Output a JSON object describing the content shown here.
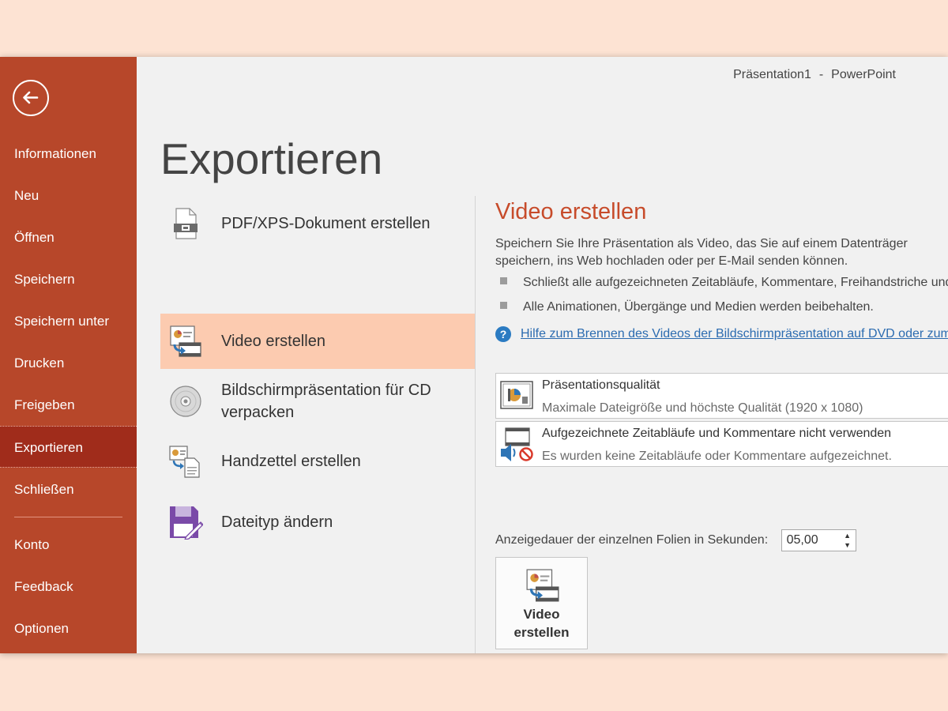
{
  "window": {
    "document_name": "Präsentation1",
    "separator": "-",
    "app_name": "PowerPoint"
  },
  "sidebar": {
    "items": [
      {
        "label": "Informationen"
      },
      {
        "label": "Neu"
      },
      {
        "label": "Öffnen"
      },
      {
        "label": "Speichern"
      },
      {
        "label": "Speichern unter"
      },
      {
        "label": "Drucken"
      },
      {
        "label": "Freigeben"
      },
      {
        "label": "Exportieren",
        "active": true
      },
      {
        "label": "Schließen"
      },
      {
        "label": "Konto"
      },
      {
        "label": "Feedback"
      },
      {
        "label": "Optionen"
      }
    ]
  },
  "page": {
    "title": "Exportieren"
  },
  "export_options": [
    {
      "label": "PDF/XPS-Dokument erstellen",
      "icon": "pdf-document-icon"
    },
    {
      "label": "Video erstellen",
      "icon": "video-icon",
      "selected": true
    },
    {
      "label": "Bildschirmpräsentation für CD verpacken",
      "icon": "cd-icon"
    },
    {
      "label": "Handzettel erstellen",
      "icon": "handout-icon"
    },
    {
      "label": "Dateityp ändern",
      "icon": "file-type-icon"
    }
  ],
  "detail": {
    "heading": "Video erstellen",
    "description": "Speichern Sie Ihre Präsentation als Video, das Sie auf einem Datenträger speichern, ins Web hochladen oder per E-Mail senden können.",
    "bullets": [
      "Schließt alle aufgezeichneten Zeitabläufe, Kommentare, Freihandstriche und Laserpointerbewegungen ein.",
      "Alle Animationen, Übergänge und Medien werden beibehalten."
    ],
    "help_link": "Hilfe zum Brennen des Videos der Bildschirmpräsentation auf DVD oder zum Hochladen ins Web",
    "quality": {
      "title": "Präsentationsqualität",
      "subtitle": "Maximale Dateigröße und höchste Qualität (1920 x 1080)"
    },
    "timings": {
      "title": "Aufgezeichnete Zeitabläufe und Kommentare nicht verwenden",
      "subtitle": "Es wurden keine Zeitabläufe oder Kommentare aufgezeichnet."
    },
    "duration_label": "Anzeigedauer der einzelnen Folien in Sekunden:",
    "duration_value": "05,00",
    "create_button": {
      "line1": "Video",
      "line2": "erstellen"
    }
  },
  "colors": {
    "sidebar_bg": "#b7472a",
    "sidebar_active": "#a02c1b",
    "accent_heading": "#c74b2a",
    "selected_item": "#fccbb0",
    "link": "#2b6bb0",
    "backdrop": "#fde3d3"
  }
}
